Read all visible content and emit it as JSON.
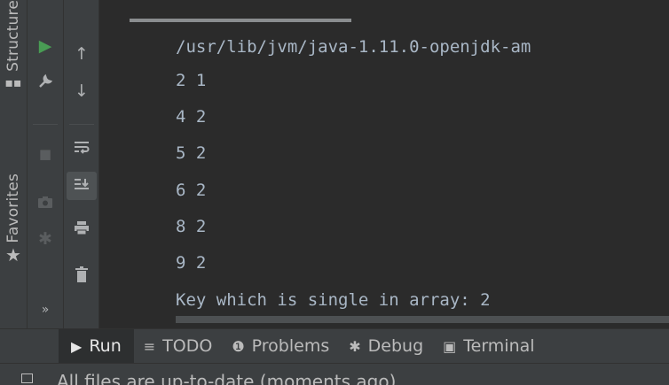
{
  "left_strip": {
    "structure": {
      "label": "Structure",
      "icon": "structure-icon"
    },
    "favorites": {
      "label": "Favorites",
      "icon": "star-icon"
    }
  },
  "toolbar": {
    "run_icon": "▶",
    "wrench_icon": "🔧",
    "stop_icon": "■",
    "camera_icon": "📷",
    "bug_icon": "✱",
    "more_icon": "»",
    "up_icon": "↑",
    "down_icon": "↓",
    "soft_wrap_icon": "⥱",
    "scroll_end_icon": "⇊",
    "print_icon": "⎙",
    "trash_icon": "🗑"
  },
  "console": {
    "lines": [
      "/usr/lib/jvm/java-1.11.0-openjdk-am",
      "2 1",
      "4 2",
      "5 2",
      "6 2",
      "8 2",
      "9 2",
      "Key which is single in array: 2"
    ]
  },
  "bottom_tabs": [
    {
      "label": "Run",
      "icon": "▶"
    },
    {
      "label": "TODO",
      "icon": "≡"
    },
    {
      "label": "Problems",
      "icon": "❶"
    },
    {
      "label": "Debug",
      "icon": "✱"
    },
    {
      "label": "Terminal",
      "icon": "▣"
    }
  ],
  "status_bar": {
    "text": "All files are up-to-date (moments ago)"
  },
  "colors": {
    "background": "#2b2b2b",
    "panel": "#3c3f41",
    "console_text": "#a9b7c6",
    "run_green": "#499c54"
  }
}
